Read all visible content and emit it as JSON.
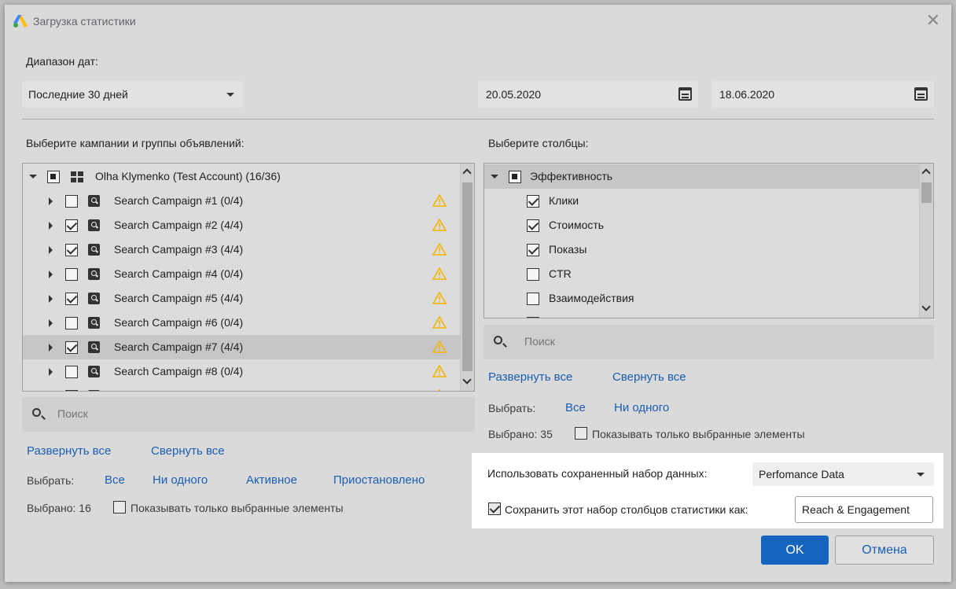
{
  "window": {
    "title": "Загрузка статистики",
    "close_glyph": "✕"
  },
  "date_range": {
    "label": "Диапазон дат:",
    "preset": "Последние 30 дней",
    "start": "20.05.2020",
    "end": "18.06.2020"
  },
  "campaigns": {
    "label": "Выберите кампании и группы объявлений:",
    "root": {
      "label": "Olha Klymenko (Test Account) (16/36)",
      "state": "partial"
    },
    "items": [
      {
        "label": "Search Campaign #1 (0/4)",
        "checked": false,
        "selected": false
      },
      {
        "label": "Search Campaign #2 (4/4)",
        "checked": true,
        "selected": false
      },
      {
        "label": "Search Campaign #3 (4/4)",
        "checked": true,
        "selected": false
      },
      {
        "label": "Search Campaign #4 (0/4)",
        "checked": false,
        "selected": false
      },
      {
        "label": "Search Campaign #5 (4/4)",
        "checked": true,
        "selected": false
      },
      {
        "label": "Search Campaign #6 (0/4)",
        "checked": false,
        "selected": false
      },
      {
        "label": "Search Campaign #7 (4/4)",
        "checked": true,
        "selected": true
      },
      {
        "label": "Search Campaign #8 (0/4)",
        "checked": false,
        "selected": false
      }
    ],
    "search_placeholder": "Поиск",
    "expand_all": "Развернуть все",
    "collapse_all": "Свернуть все",
    "select_label": "Выбрать:",
    "select_all": "Все",
    "select_none": "Ни одного",
    "select_active": "Активное",
    "select_paused": "Приостановлено",
    "selected_count": "Выбрано: 16",
    "show_only_selected": "Показывать только выбранные элементы"
  },
  "columns": {
    "label": "Выберите столбцы:",
    "root": {
      "label": "Эффективность",
      "state": "partial"
    },
    "items": [
      {
        "label": "Клики",
        "checked": true
      },
      {
        "label": "Стоимость",
        "checked": true
      },
      {
        "label": "Показы",
        "checked": true
      },
      {
        "label": "CTR",
        "checked": false
      },
      {
        "label": "Взаимодействия",
        "checked": false
      }
    ],
    "search_placeholder": "Поиск",
    "expand_all": "Развернуть все",
    "collapse_all": "Свернуть все",
    "select_label": "Выбрать:",
    "select_all": "Все",
    "select_none": "Ни одного",
    "selected_count": "Выбрано: 35",
    "show_only_selected": "Показывать только выбранные элементы"
  },
  "saved_set": {
    "use_label": "Использовать сохраненный набор данных:",
    "use_value": "Perfomance Data",
    "save_label": "Сохранить этот набор столбцов статистики как:",
    "save_checked": true,
    "save_value": "Reach & Engagement"
  },
  "buttons": {
    "ok": "OK",
    "cancel": "Отмена"
  },
  "colors": {
    "accent": "#1565c0",
    "link": "#1a5fb4",
    "warning": "#f4b400"
  }
}
